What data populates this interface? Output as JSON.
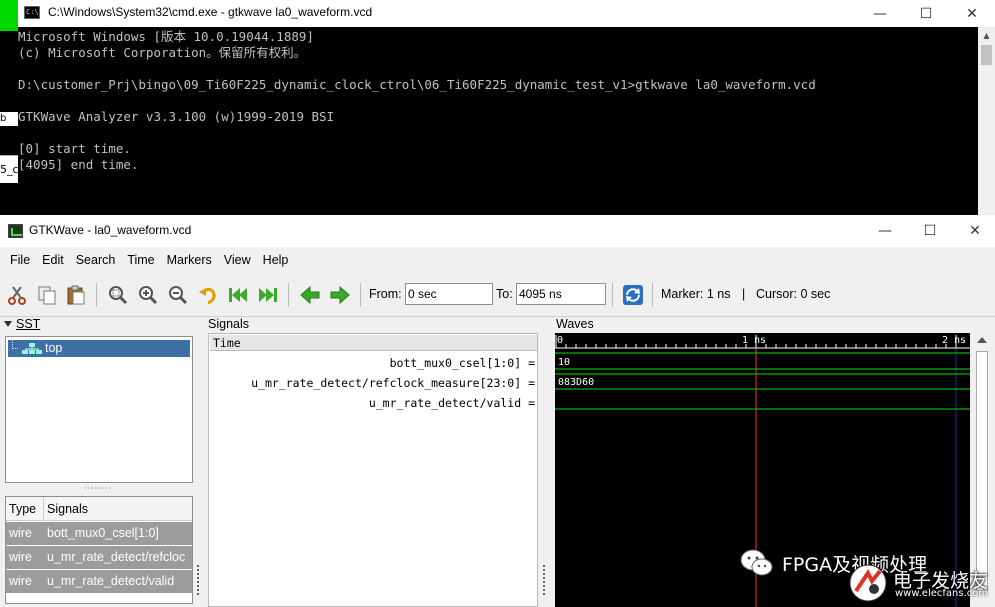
{
  "cmd": {
    "title": "C:\\Windows\\System32\\cmd.exe - gtkwave  la0_waveform.vcd",
    "icon_text": "C:\\",
    "lines": [
      "Microsoft Windows [版本 10.0.19044.1889]",
      "(c) Microsoft Corporation。保留所有权利。",
      "",
      "D:\\customer_Prj\\bingo\\09_Ti60F225_dynamic_clock_ctrol\\06_Ti60F225_dynamic_test_v1>gtkwave la0_waveform.vcd",
      "",
      "GTKWave Analyzer v3.3.100 (w)1999-2019 BSI",
      "",
      "[0] start time.",
      "[4095] end time."
    ],
    "bg_text_b": "b",
    "bg_text_c": "5_c"
  },
  "gtk": {
    "title": "GTKWave - la0_waveform.vcd",
    "menu": [
      "File",
      "Edit",
      "Search",
      "Time",
      "Markers",
      "View",
      "Help"
    ],
    "toolbar": {
      "from_label": "From:",
      "from_value": "0 sec",
      "to_label": "To:",
      "to_value": "4095 ns",
      "marker_text": "Marker: 1 ns",
      "separator": "|",
      "cursor_text": "Cursor: 0 sec"
    },
    "sst": {
      "title": "SST",
      "tree_item": "top",
      "table_headers": [
        "Type",
        "Signals"
      ],
      "rows": [
        {
          "type": "wire",
          "name": "bott_mux0_csel[1:0]"
        },
        {
          "type": "wire",
          "name": "u_mr_rate_detect/refcloc"
        },
        {
          "type": "wire",
          "name": "u_mr_rate_detect/valid"
        }
      ]
    },
    "signals": {
      "title": "Signals",
      "time_header": "Time",
      "names": [
        "bott_mux0_csel[1:0] =",
        "u_mr_rate_detect/refclock_measure[23:0] =",
        "u_mr_rate_detect/valid ="
      ]
    },
    "waves": {
      "title": "Waves",
      "tick_labels": [
        "0",
        "1 ns",
        "2 ns"
      ],
      "values": [
        "10",
        "083D60",
        ""
      ],
      "colors": {
        "bus": "#00e000",
        "marker": "#ff3030",
        "grid": "#2a2aa0",
        "ticks": "#ffffff",
        "text": "#ffffff"
      }
    }
  },
  "watermark": {
    "brand": "FPGA及视频处理",
    "site_cn": "电子发烧友",
    "site_url": "www.elecfans.com"
  }
}
